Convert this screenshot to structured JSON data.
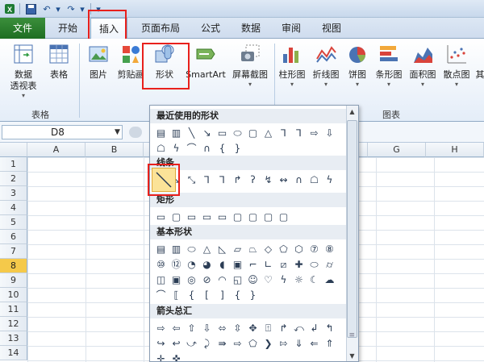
{
  "ribbon_tabs": [
    {
      "label": "文件"
    },
    {
      "label": "开始"
    },
    {
      "label": "插入"
    },
    {
      "label": "页面布局"
    },
    {
      "label": "公式"
    },
    {
      "label": "数据"
    },
    {
      "label": "审阅"
    },
    {
      "label": "视图"
    }
  ],
  "ribbon": {
    "pivot_label_1": "数据",
    "pivot_label_2": "透视表",
    "table_label": "表格",
    "group_tables": "表格",
    "picture_label": "图片",
    "clipart_label": "剪贴画",
    "shapes_label": "形状",
    "smartart_label": "SmartArt",
    "screenshot_label": "屏幕截图",
    "column_chart": "柱形图",
    "line_chart": "折线图",
    "pie_chart": "饼图",
    "bar_chart": "条形图",
    "area_chart": "面积图",
    "scatter_chart": "散点图",
    "other_chart": "其",
    "group_charts": "图表"
  },
  "formula_bar": {
    "namebox_value": "D8"
  },
  "grid": {
    "columns": [
      "A",
      "B",
      "",
      "",
      "",
      "F",
      "G",
      "H"
    ],
    "rows": [
      "1",
      "2",
      "3",
      "4",
      "5",
      "6",
      "7",
      "8",
      "9",
      "10",
      "11",
      "12",
      "13",
      "14"
    ],
    "selected_row": "8"
  },
  "shapes_panel": {
    "section_recent": "最近使用的形状",
    "section_lines": "线条",
    "section_rect": "矩形",
    "section_basic": "基本形状",
    "section_arrows": "箭头总汇"
  },
  "colors": {
    "highlight_red": "#e8201c",
    "file_tab_green": "#1e6e22",
    "selected_row": "#f5c94a"
  }
}
